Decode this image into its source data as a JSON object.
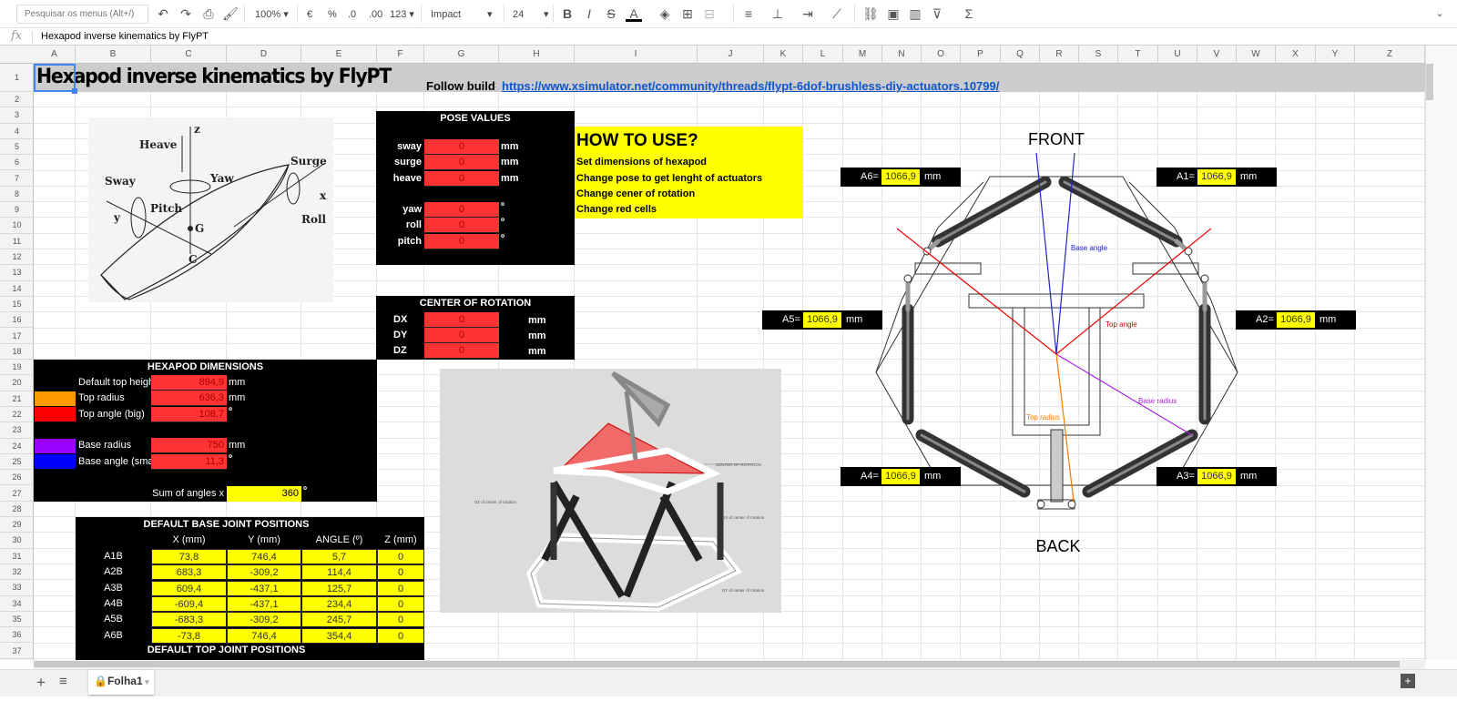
{
  "toolbar": {
    "search_placeholder": "Pesquisar os menus (Alt+/)",
    "zoom": "100%",
    "currency": "€",
    "percent": "%",
    "dec_decrease": ".0",
    "dec_increase": ".00",
    "format": "123",
    "font": "Impact",
    "font_size": "24"
  },
  "formula_bar": {
    "fx": "fx",
    "value": "Hexapod inverse kinematics by FlyPT"
  },
  "columns": [
    "A",
    "B",
    "C",
    "D",
    "E",
    "F",
    "G",
    "H",
    "I",
    "J",
    "K",
    "L",
    "M",
    "N",
    "O",
    "P",
    "Q",
    "R",
    "S",
    "T",
    "U",
    "V",
    "W",
    "X",
    "Y",
    "Z"
  ],
  "row_numbers": [
    "1",
    "2",
    "3",
    "4",
    "5",
    "6",
    "7",
    "8",
    "9",
    "10",
    "11",
    "12",
    "13",
    "14",
    "15",
    "16",
    "17",
    "18",
    "19",
    "20",
    "21",
    "22",
    "23",
    "24",
    "25",
    "26",
    "27",
    "28",
    "29",
    "30",
    "31",
    "32",
    "33",
    "34",
    "35",
    "36",
    "37"
  ],
  "sheet": {
    "title": "Hexapod inverse kinematics by FlyPT",
    "follow_label": "Follow build",
    "follow_sep": ":",
    "link": "https://www.xsimulator.net/community/threads/flypt-6dof-brushless-diy-actuators.10799/"
  },
  "pose": {
    "title": "POSE VALUES",
    "rows": [
      {
        "label": "sway",
        "value": "0",
        "unit": "mm"
      },
      {
        "label": "surge",
        "value": "0",
        "unit": "mm"
      },
      {
        "label": "heave",
        "value": "0",
        "unit": "mm"
      },
      {
        "label": "yaw",
        "value": "0",
        "unit": "º"
      },
      {
        "label": "roll",
        "value": "0",
        "unit": "º"
      },
      {
        "label": "pitch",
        "value": "0",
        "unit": "º"
      }
    ]
  },
  "how_to": {
    "title": "HOW TO USE?",
    "steps": [
      "Set dimensions of hexapod",
      "Change pose to get lenght of actuators",
      "Change cener of rotation",
      "Change red cells"
    ]
  },
  "center": {
    "title": "CENTER OF ROTATION",
    "rows": [
      {
        "label": "DX",
        "value": "0",
        "unit": "mm"
      },
      {
        "label": "DY",
        "value": "0",
        "unit": "mm"
      },
      {
        "label": "DZ",
        "value": "0",
        "unit": "mm"
      }
    ]
  },
  "dims": {
    "title": "HEXAPOD DIMENSIONS",
    "rows": [
      {
        "label": "Default top heigh",
        "value": "894,9",
        "unit": "mm",
        "swatch": ""
      },
      {
        "label": "Top radius",
        "value": "636,3",
        "unit": "mm",
        "swatch": "#ff9900"
      },
      {
        "label": "Top angle (big)",
        "value": "108,7",
        "unit": "º",
        "swatch": "#ff0000"
      },
      {
        "label": "Base radius",
        "value": "750",
        "unit": "mm",
        "swatch": "#9900ff"
      },
      {
        "label": "Base angle (sma",
        "value": "11,3",
        "unit": "º",
        "swatch": "#0000ff"
      }
    ],
    "sum": {
      "label": "Sum of angles x",
      "value": "360",
      "unit": "º"
    }
  },
  "base_table": {
    "title": "DEFAULT BASE JOINT POSITIONS",
    "headers": [
      "X (mm)",
      "Y (mm)",
      "ANGLE (º)",
      "Z (mm)"
    ],
    "rows": [
      {
        "id": "A1B",
        "x": "73,8",
        "y": "746,4",
        "angle": "5,7",
        "z": "0"
      },
      {
        "id": "A2B",
        "x": "683,3",
        "y": "-309,2",
        "angle": "114,4",
        "z": "0"
      },
      {
        "id": "A3B",
        "x": "609,4",
        "y": "-437,1",
        "angle": "125,7",
        "z": "0"
      },
      {
        "id": "A4B",
        "x": "-609,4",
        "y": "-437,1",
        "angle": "234,4",
        "z": "0"
      },
      {
        "id": "A5B",
        "x": "-683,3",
        "y": "-309,2",
        "angle": "245,7",
        "z": "0"
      },
      {
        "id": "A6B",
        "x": "-73,8",
        "y": "746,4",
        "angle": "354,4",
        "z": "0"
      }
    ],
    "next_title": "DEFAULT TOP JOINT POSITIONS"
  },
  "boat": {
    "heave": "Heave",
    "z": "z",
    "yaw": "Yaw",
    "surge": "Surge",
    "sway": "Sway",
    "pitch": "Pitch",
    "x": "x",
    "y": "y",
    "g": "G",
    "roll": "Roll",
    "c": "C"
  },
  "render": {
    "center": "CENTER OF ROTATION",
    "dz": "DZ of center of rotation",
    "dx": "DX of center of rotation",
    "dy": "DY of center of rotation"
  },
  "diagram": {
    "front": "FRONT",
    "back": "BACK",
    "actuators": [
      {
        "label": "A1=",
        "value": "1066,9",
        "unit": "mm"
      },
      {
        "label": "A2=",
        "value": "1066,9",
        "unit": "mm"
      },
      {
        "label": "A3=",
        "value": "1066,9",
        "unit": "mm"
      },
      {
        "label": "A4=",
        "value": "1066,9",
        "unit": "mm"
      },
      {
        "label": "A5=",
        "value": "1066,9",
        "unit": "mm"
      },
      {
        "label": "A6=",
        "value": "1066,9",
        "unit": "mm"
      }
    ],
    "base_angle": "Base angle",
    "top_angle": "Top angle",
    "base_radius": "Base radius",
    "top_radius": "Top radius"
  },
  "tabs": {
    "sheet": "Folha1"
  },
  "colors": {
    "red_cell": "#ff3333",
    "yellow_cell": "#ffff00",
    "link": "#1155cc",
    "header_band": "#cccccc"
  }
}
